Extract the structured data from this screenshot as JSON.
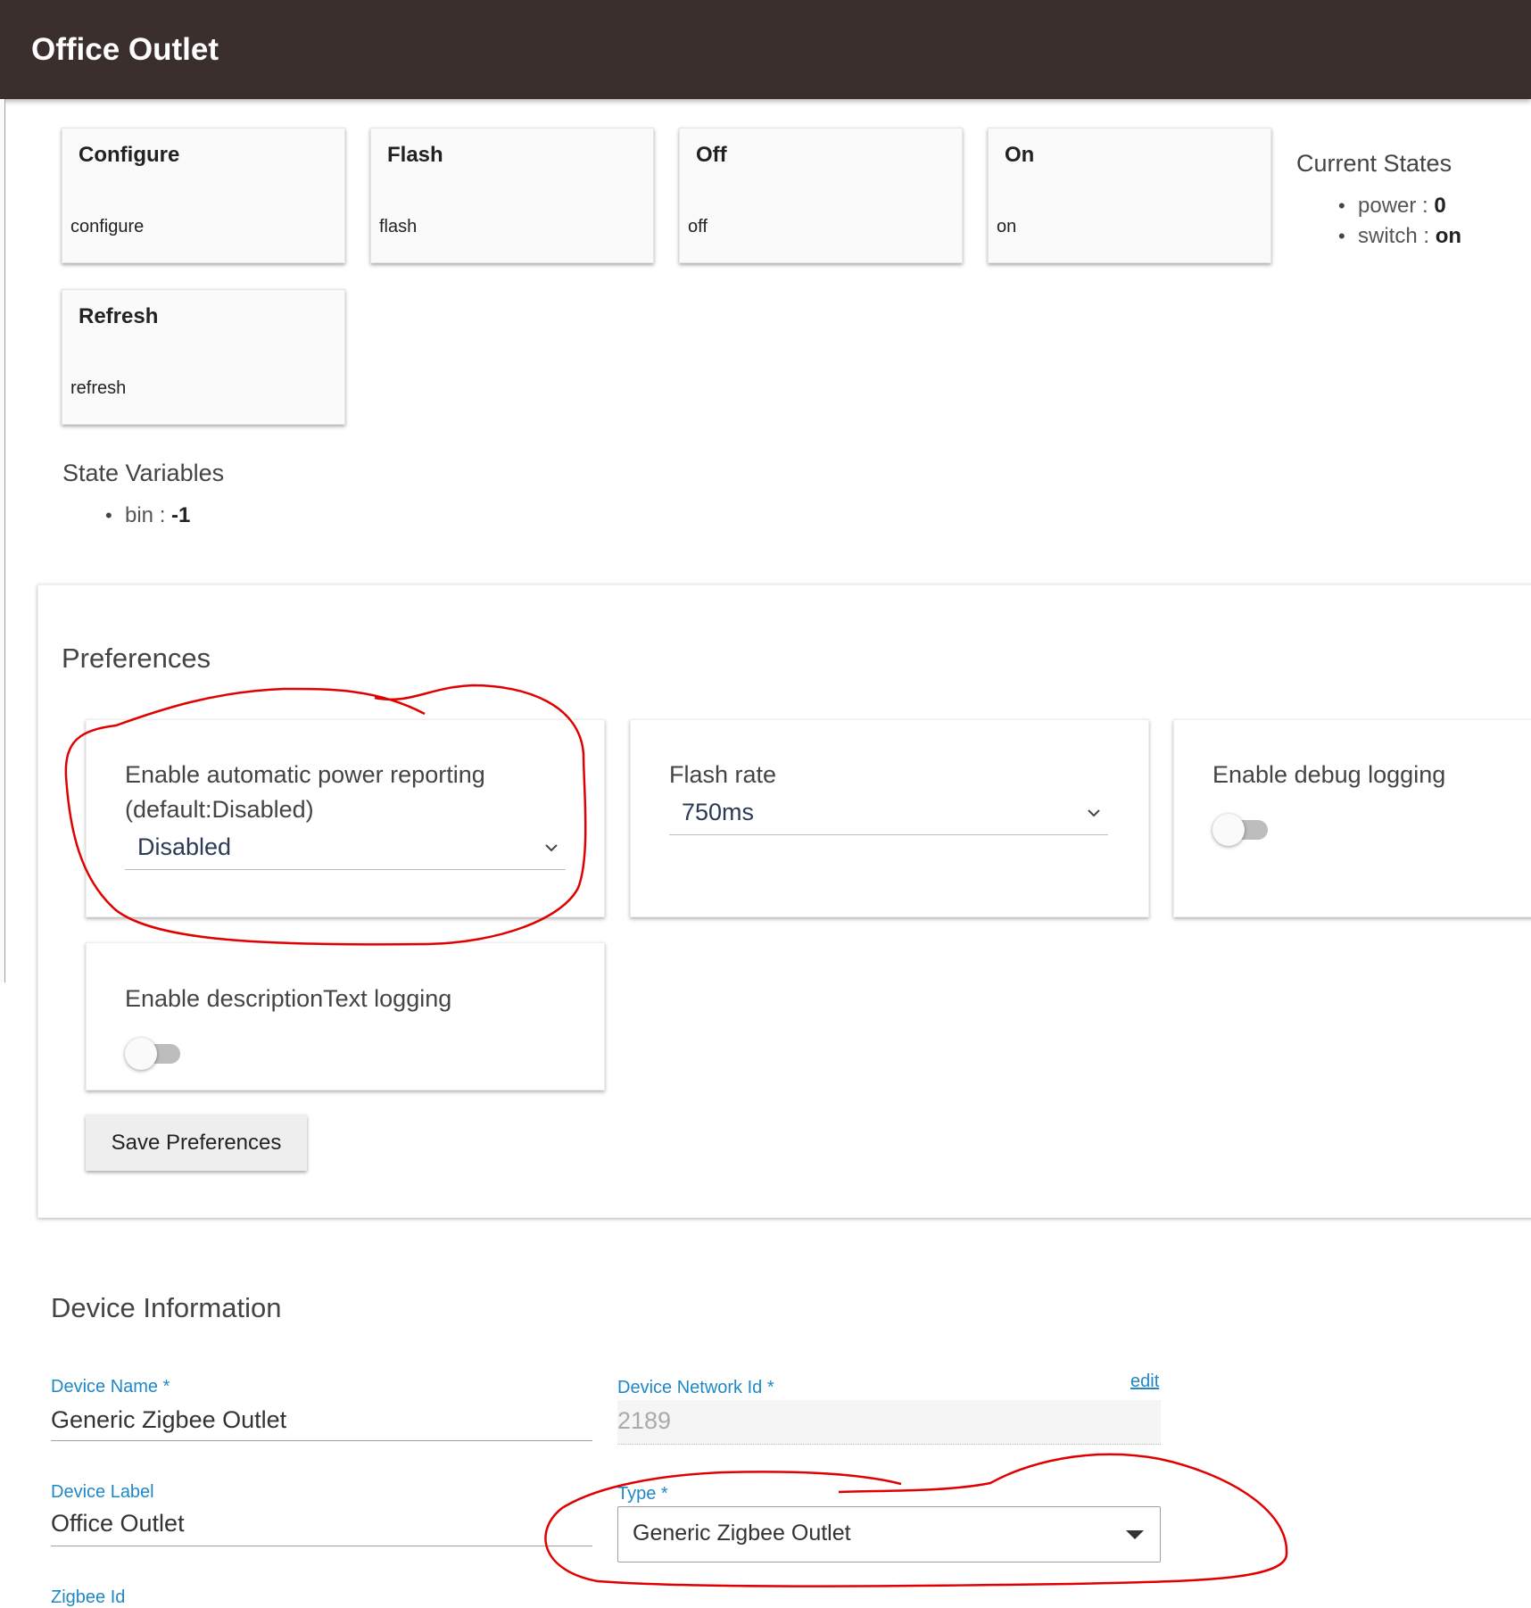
{
  "header": {
    "title": "Office Outlet"
  },
  "commands": [
    {
      "name": "Configure",
      "value": "configure"
    },
    {
      "name": "Flash",
      "value": "flash"
    },
    {
      "name": "Off",
      "value": "off"
    },
    {
      "name": "On",
      "value": "on"
    },
    {
      "name": "Refresh",
      "value": "refresh"
    }
  ],
  "current_states": {
    "title": "Current States",
    "items": [
      {
        "key": "power",
        "sep": " : ",
        "value": "0"
      },
      {
        "key": "switch",
        "sep": " : ",
        "value": "on"
      }
    ]
  },
  "state_variables": {
    "title": "State Variables",
    "items": [
      {
        "key": "bin",
        "sep": " : ",
        "value": "-1"
      }
    ]
  },
  "preferences": {
    "title": "Preferences",
    "power_reporting": {
      "label_line1": "Enable automatic power reporting",
      "label_line2": "(default:Disabled)",
      "value": "Disabled"
    },
    "flash_rate": {
      "label": "Flash rate",
      "value": "750ms"
    },
    "debug_logging": {
      "label": "Enable debug logging",
      "enabled": false
    },
    "description_logging": {
      "label": "Enable descriptionText logging",
      "enabled": false
    },
    "save_label": "Save Preferences"
  },
  "device_info": {
    "title": "Device Information",
    "device_name": {
      "label": "Device Name *",
      "value": "Generic Zigbee Outlet"
    },
    "network_id": {
      "label": "Device Network Id *",
      "value": "2189",
      "edit_label": "edit"
    },
    "device_label": {
      "label": "Device Label",
      "value": "Office Outlet"
    },
    "type": {
      "label": "Type *",
      "value": "Generic Zigbee Outlet"
    },
    "next_label_cut": "Zigbee Id"
  },
  "colors": {
    "header_bg": "#3a2f2c",
    "label_blue": "#1e88c7",
    "annotation_red": "#e00000"
  }
}
